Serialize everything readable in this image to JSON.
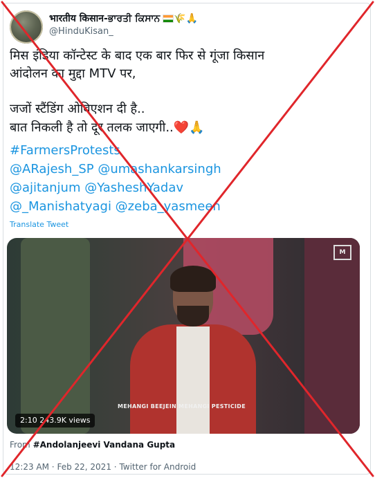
{
  "profile": {
    "display_name": "भारतीय किसान-ਭਾਰਤੀ ਕਿਸਾਨ",
    "name_emojis": "🌾🙏",
    "handle": "@HinduKisan_"
  },
  "tweet": {
    "line1": "मिस इंडिया कॉन्टेस्ट के बाद एक बार फिर से गूंजा किसान",
    "line2": "आंदोलन का मुद्दा MTV पर,",
    "line3": "जजों स्टैंडिंग ओबिएशन दी है..",
    "line4": "बात निकली है तो दूर तलक जाएगी..❤️🙏",
    "hashtag": "#FarmersProtests",
    "mentions1": "@ARajesh_SP @umashankarsingh",
    "mentions2": "@ajitanjum @YasheshYadav",
    "mentions3": "@_Manishatyagi @zeba_yasmeen",
    "translate": "Translate Tweet"
  },
  "video": {
    "time": "2:10",
    "views": "243.9K views",
    "caption": "MEHANGI BEEJEIN MEHANGI PESTICIDE",
    "logo": "M"
  },
  "attribution": {
    "from_label": "From",
    "source": "#Andolanjeevi Vandana Gupta"
  },
  "meta": {
    "time": "12:23 AM",
    "date": "Feb 22, 2021",
    "client": "Twitter for Android",
    "separator": "·"
  },
  "overlay": {
    "cross_color": "#e0262b"
  }
}
